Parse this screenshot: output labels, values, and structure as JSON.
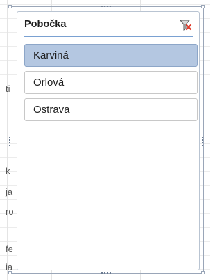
{
  "slicer": {
    "title": "Pobočka",
    "clear_filter_icon": "filter-clear-icon",
    "items": [
      {
        "label": "Karviná",
        "selected": true
      },
      {
        "label": "Orlová",
        "selected": false
      },
      {
        "label": "Ostrava",
        "selected": false
      }
    ]
  },
  "colors": {
    "selected_fill": "#b4c7e1",
    "header_rule": "#7aa1d2",
    "clear_icon_x": "#e03a2a"
  }
}
